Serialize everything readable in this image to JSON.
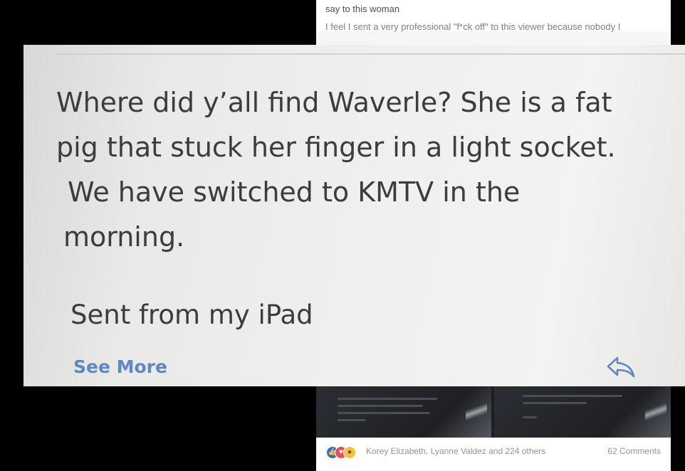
{
  "facebook_post": {
    "text_line_1": "say to this woman",
    "text_line_2": "I feel I sent a very professional \"f*ck off\" to this viewer because nobody I",
    "reactions": [
      "like-icon",
      "love-icon",
      "wow-icon"
    ],
    "reactors": "Korey Elizabeth, Lyanne Valdez and 224 others",
    "comments": "62 Comments"
  },
  "email": {
    "lines": [
      "Where did y’all find Waverle?  She is a fat",
      "pig that stuck her finger in a light socket.",
      "We have switched to KMTV in the",
      "morning."
    ],
    "signature": "Sent from my iPad",
    "see_more_label": "See More",
    "reply_icon": "reply-arrow-icon"
  },
  "colors": {
    "link_blue": "#5f87c4",
    "email_text": "#3c3c3c",
    "background": "#000000"
  }
}
